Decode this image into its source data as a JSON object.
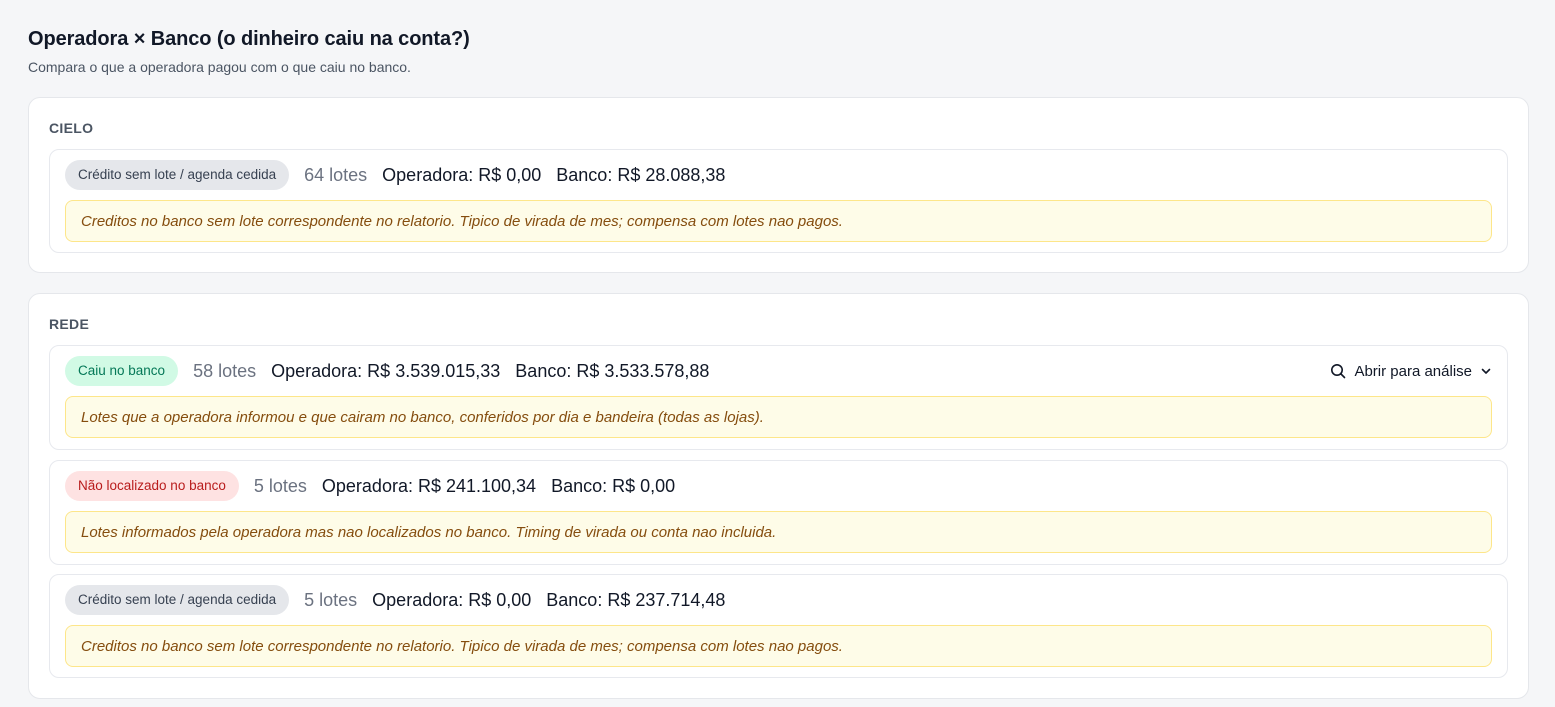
{
  "header": {
    "title": "Operadora × Banco (o dinheiro caiu na conta?)",
    "subtitle": "Compara o que a operadora pagou com o que caiu no banco."
  },
  "groups": [
    {
      "name": "CIELO",
      "rows": [
        {
          "status": "Crédito sem lote / agenda cedida",
          "status_color": "#e5e7eb",
          "lotes": "64 lotes",
          "operadora": "Operadora: R$ 0,00",
          "banco": "Banco: R$ 28.088,38",
          "note": "Creditos no banco sem lote correspondente no relatorio. Tipico de virada de mes; compensa com lotes nao pagos."
        }
      ]
    },
    {
      "name": "REDE",
      "rows": [
        {
          "status": "Caiu no banco",
          "status_color": "#d1fae5",
          "lotes": "58 lotes",
          "operadora": "Operadora: R$ 3.539.015,33",
          "banco": "Banco: R$ 3.533.578,88",
          "action_label": "Abrir para análise",
          "action_icon": "search-icon",
          "action_chevron": "chevron-down-icon",
          "note": "Lotes que a operadora informou e que cairam no banco, conferidos por dia e bandeira (todas as lojas)."
        },
        {
          "status": "Não localizado no banco",
          "status_color": "#fee2e2",
          "lotes": "5 lotes",
          "operadora": "Operadora: R$ 241.100,34",
          "banco": "Banco: R$ 0,00",
          "note": "Lotes informados pela operadora mas nao localizados no banco. Timing de virada ou conta nao incluida."
        },
        {
          "status": "Crédito sem lote / agenda cedida",
          "status_color": "#e5e7eb",
          "lotes": "5 lotes",
          "operadora": "Operadora: R$ 0,00",
          "banco": "Banco: R$ 237.714,48",
          "note": "Creditos no banco sem lote correspondente no relatorio. Tipico de virada de mes; compensa com lotes nao pagos."
        }
      ]
    }
  ]
}
